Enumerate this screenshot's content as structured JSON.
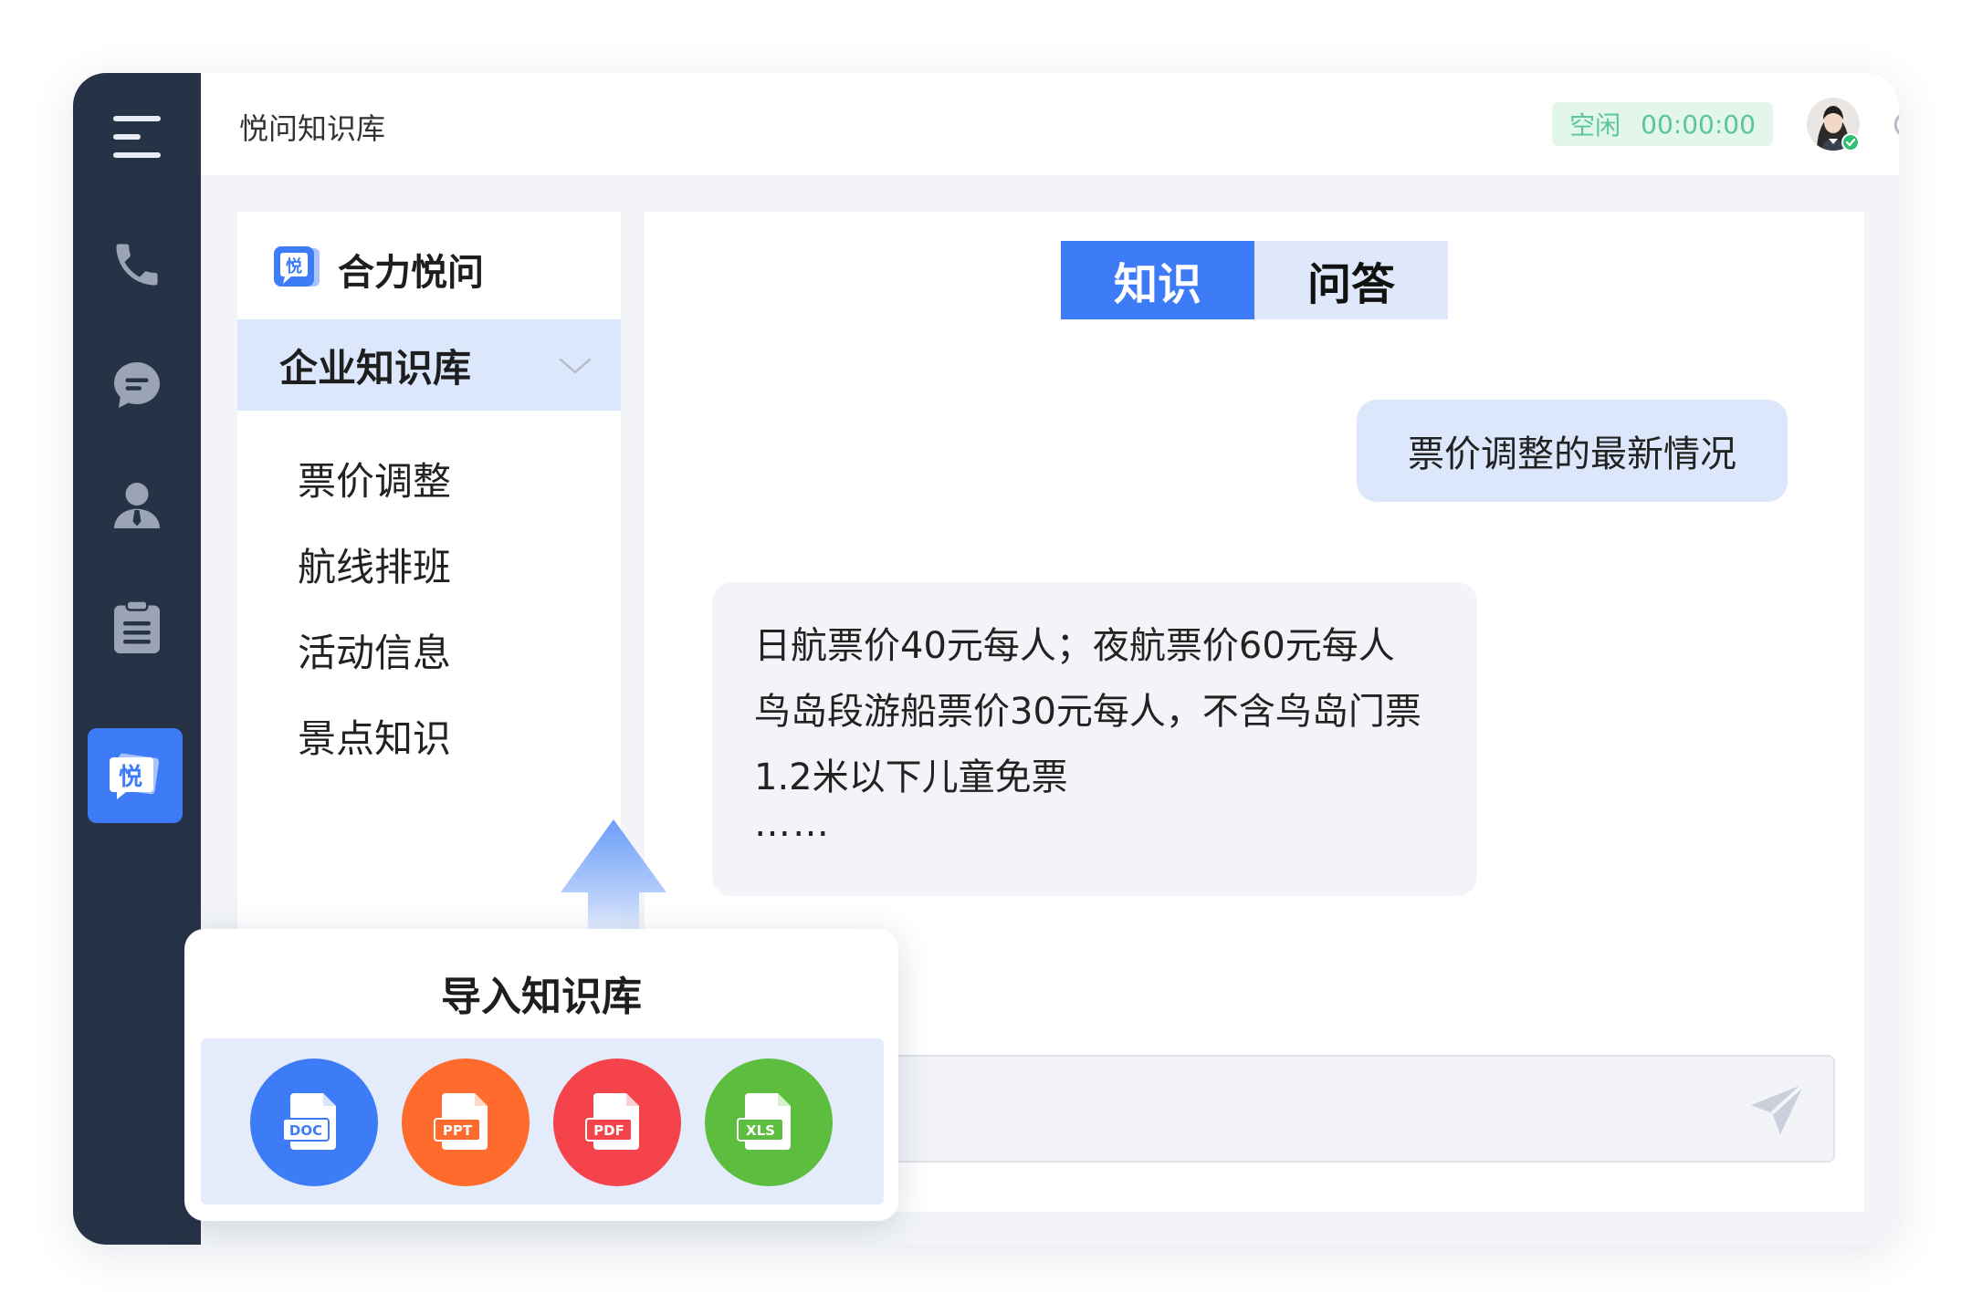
{
  "app": {
    "title": "悦问知识库"
  },
  "status": {
    "label": "空闲",
    "timer": "00:00:00",
    "color": "#5dc59a"
  },
  "sidebar": {
    "items": [
      {
        "icon": "menu-icon"
      },
      {
        "icon": "phone-icon"
      },
      {
        "icon": "chat-icon"
      },
      {
        "icon": "contact-icon"
      },
      {
        "icon": "clipboard-icon"
      },
      {
        "icon": "knowledge-icon",
        "logo_text": "悦",
        "active": true
      }
    ]
  },
  "brand": {
    "name": "合力悦问",
    "logo_text": "悦"
  },
  "knowledge_base": {
    "title": "企业知识库",
    "items": [
      "票价调整",
      "航线排班",
      "活动信息",
      "景点知识"
    ]
  },
  "tabs": [
    {
      "label": "知识",
      "active": true
    },
    {
      "label": "问答",
      "active": false
    }
  ],
  "chat": {
    "question": "票价调整的最新情况",
    "answer_lines": [
      "日航票价40元每人；夜航票价60元每人",
      "鸟岛段游船票价30元每人，不含鸟岛门票",
      "1.2米以下儿童免票"
    ],
    "answer_ellipsis": "……"
  },
  "import": {
    "title": "导入知识库",
    "files": [
      {
        "label": "DOC",
        "color": "#3d7bf7"
      },
      {
        "label": "PPT",
        "color": "#ff6b2c"
      },
      {
        "label": "PDF",
        "color": "#f5434b"
      },
      {
        "label": "XLS",
        "color": "#5cbd3f"
      }
    ]
  },
  "colors": {
    "accent": "#3d7bf7",
    "sidebar": "#263245",
    "highlight": "#dce7fb"
  }
}
